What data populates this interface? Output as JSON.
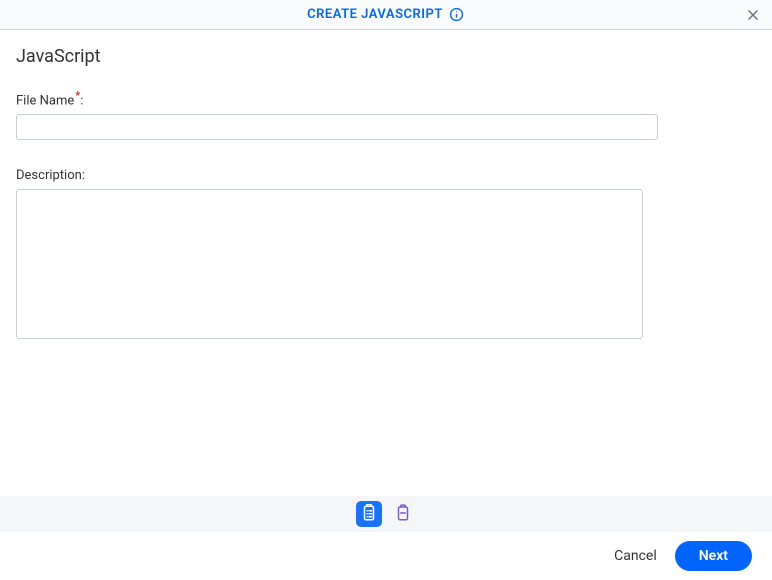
{
  "header": {
    "title": "CREATE JAVASCRIPT"
  },
  "page": {
    "title": "JavaScript"
  },
  "fields": {
    "file_name": {
      "label": "File Name",
      "required": true,
      "value": ""
    },
    "description": {
      "label": "Description",
      "required": false,
      "value": ""
    }
  },
  "toolbar": {
    "form_icon": "form-view-icon",
    "clipboard_icon": "clipboard-icon"
  },
  "footer": {
    "cancel_label": "Cancel",
    "next_label": "Next"
  }
}
